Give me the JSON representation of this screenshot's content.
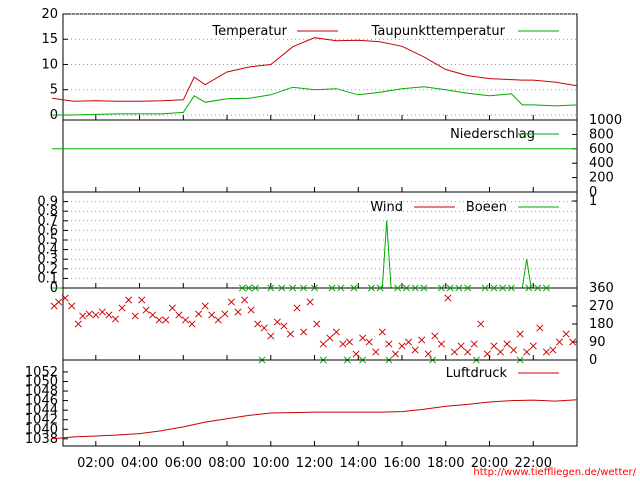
{
  "time_ticks": [
    "02:00",
    "04:00",
    "06:00",
    "08:00",
    "10:00",
    "12:00",
    "14:00",
    "16:00",
    "18:00",
    "20:00",
    "22:00"
  ],
  "credit": "http://www.tiefflie­gen.de/wetter/",
  "colors": {
    "red": "#cc0000",
    "green": "#00aa00",
    "grid": "#999999"
  },
  "chart_data": [
    {
      "type": "line",
      "legend_placement": "top",
      "ylim": [
        -1,
        20
      ],
      "yticks": [
        "0",
        "5",
        "10",
        "15",
        "20"
      ],
      "x_hours": [
        0.0,
        1.0,
        2.0,
        3.0,
        4.0,
        5.0,
        6.0,
        6.5,
        7.0,
        8.0,
        9.0,
        10.0,
        11.0,
        12.0,
        13.0,
        14.0,
        15.0,
        16.0,
        17.0,
        18.0,
        19.0,
        20.0,
        21.0,
        21.5,
        22.0,
        23.0,
        24.0
      ],
      "series": [
        {
          "name": "Temperatur",
          "color": "#cc0000",
          "values": [
            3.3,
            2.7,
            2.8,
            2.7,
            2.7,
            2.8,
            3.0,
            7.5,
            6.0,
            8.5,
            9.5,
            10.0,
            13.5,
            15.3,
            14.7,
            14.8,
            14.5,
            13.6,
            11.5,
            9.0,
            7.8,
            7.2,
            7.0,
            6.9,
            6.9,
            6.5,
            5.8
          ]
        },
        {
          "name": "Taupunkttemperatur",
          "color": "#00aa00",
          "values": [
            0.0,
            0.0,
            0.1,
            0.2,
            0.2,
            0.2,
            0.5,
            3.8,
            2.5,
            3.2,
            3.3,
            4.0,
            5.5,
            5.0,
            5.2,
            4.0,
            4.5,
            5.2,
            5.6,
            5.0,
            4.3,
            3.8,
            4.2,
            2.0,
            2.0,
            1.8,
            2.0
          ]
        }
      ]
    },
    {
      "type": "line",
      "ylim": [
        0,
        1000
      ],
      "yticks": [
        "0",
        "200",
        "400",
        "600",
        "800",
        "1000"
      ],
      "series": [
        {
          "name": "Niederschlag",
          "color": "#00aa00",
          "x_hours": [
            0,
            24
          ],
          "values": [
            600,
            600
          ]
        }
      ]
    },
    {
      "type": "line",
      "legend_placement": "top",
      "ylim": [
        0,
        1
      ],
      "yticks": [
        "0",
        "0.1",
        "0.2",
        "0.3",
        "0.4",
        "0.5",
        "0.6",
        "0.7",
        "0.8",
        "0.9"
      ],
      "right_ticks": [
        "1"
      ],
      "series": [
        {
          "name": "Wind",
          "color": "#cc0000",
          "x_hours": [
            0,
            24
          ],
          "values": [
            0,
            0
          ]
        },
        {
          "name": "Boeen",
          "color": "#00aa00",
          "x_hours": [
            0,
            15.1,
            15.3,
            15.5,
            21.5,
            21.7,
            21.9,
            24
          ],
          "values": [
            0,
            0,
            0.7,
            0,
            0,
            0.3,
            0,
            0
          ]
        }
      ]
    },
    {
      "type": "scatter",
      "ylim": [
        0,
        360
      ],
      "right_ticks": [
        "0",
        "90",
        "180",
        "270",
        "360"
      ],
      "series": [
        {
          "name": "",
          "color": "#cc0000",
          "x_hours": [
            0.1,
            0.3,
            0.6,
            0.9,
            1.2,
            1.4,
            1.7,
            2.0,
            2.3,
            2.6,
            2.9,
            3.2,
            3.5,
            3.8,
            4.1,
            4.3,
            4.6,
            4.9,
            5.2,
            5.5,
            5.8,
            6.1,
            6.4,
            6.7,
            7.0,
            7.3,
            7.6,
            7.9,
            8.2,
            8.5,
            8.8,
            9.1,
            9.4,
            9.7,
            10.0,
            10.3,
            10.6,
            10.9,
            11.2,
            11.5,
            11.8,
            12.1,
            12.4,
            12.7,
            13.0,
            13.3,
            13.6,
            13.9,
            14.2,
            14.5,
            14.8,
            15.1,
            15.4,
            15.7,
            16.0,
            16.3,
            16.6,
            16.9,
            17.2,
            17.5,
            17.8,
            18.1,
            18.4,
            18.7,
            19.0,
            19.3,
            19.6,
            19.9,
            20.2,
            20.5,
            20.8,
            21.1,
            21.4,
            21.7,
            22.0,
            22.3,
            22.6,
            22.9,
            23.2,
            23.5,
            23.8
          ],
          "values": [
            270,
            290,
            310,
            270,
            180,
            220,
            230,
            225,
            240,
            225,
            205,
            260,
            300,
            220,
            300,
            250,
            225,
            200,
            200,
            260,
            225,
            200,
            180,
            230,
            270,
            225,
            200,
            230,
            290,
            240,
            300,
            250,
            180,
            160,
            120,
            190,
            170,
            130,
            260,
            140,
            290,
            180,
            80,
            110,
            140,
            80,
            90,
            30,
            110,
            90,
            40,
            140,
            80,
            30,
            70,
            90,
            50,
            100,
            30,
            120,
            80,
            310,
            40,
            70,
            40,
            80,
            180,
            30,
            70,
            40,
            80,
            50,
            130,
            40,
            70,
            160,
            40,
            50,
            90,
            130,
            90
          ]
        },
        {
          "name": "",
          "color": "#00aa00",
          "x_hours": [
            8.7,
            9.0,
            9.3,
            9.6,
            10.0,
            10.5,
            11.0,
            11.5,
            12.0,
            12.4,
            12.8,
            13.2,
            13.5,
            13.8,
            14.2,
            14.6,
            15.0,
            15.4,
            15.8,
            16.2,
            16.6,
            17.0,
            17.4,
            17.8,
            18.2,
            18.6,
            19.0,
            19.4,
            19.8,
            20.2,
            20.6,
            21.0,
            21.4,
            21.8,
            22.2,
            22.6
          ],
          "values": [
            360,
            360,
            360,
            0,
            360,
            360,
            360,
            360,
            360,
            0,
            360,
            360,
            0,
            360,
            0,
            360,
            360,
            0,
            360,
            360,
            360,
            360,
            0,
            360,
            360,
            360,
            360,
            0,
            360,
            360,
            360,
            360,
            0,
            360,
            360,
            360
          ]
        }
      ]
    },
    {
      "type": "line",
      "legend_placement": "top",
      "ylim": [
        1036.5,
        1054.5
      ],
      "yticks": [
        "1038",
        "1040",
        "1042",
        "1044",
        "1046",
        "1048",
        "1050",
        "1052"
      ],
      "x_hours": [
        0,
        1,
        2,
        3,
        4,
        5,
        6,
        7,
        8,
        9,
        10,
        11,
        12,
        13,
        14,
        15,
        16,
        17,
        18,
        19,
        20,
        21,
        22,
        23,
        24
      ],
      "series": [
        {
          "name": "Luftdruck",
          "color": "#cc0000",
          "values": [
            1038.0,
            1038.4,
            1038.6,
            1038.8,
            1039.1,
            1039.7,
            1040.5,
            1041.5,
            1042.2,
            1042.9,
            1043.4,
            1043.5,
            1043.6,
            1043.6,
            1043.6,
            1043.6,
            1043.7,
            1044.2,
            1044.8,
            1045.2,
            1045.7,
            1046.0,
            1046.1,
            1045.9,
            1046.2
          ]
        }
      ]
    }
  ]
}
